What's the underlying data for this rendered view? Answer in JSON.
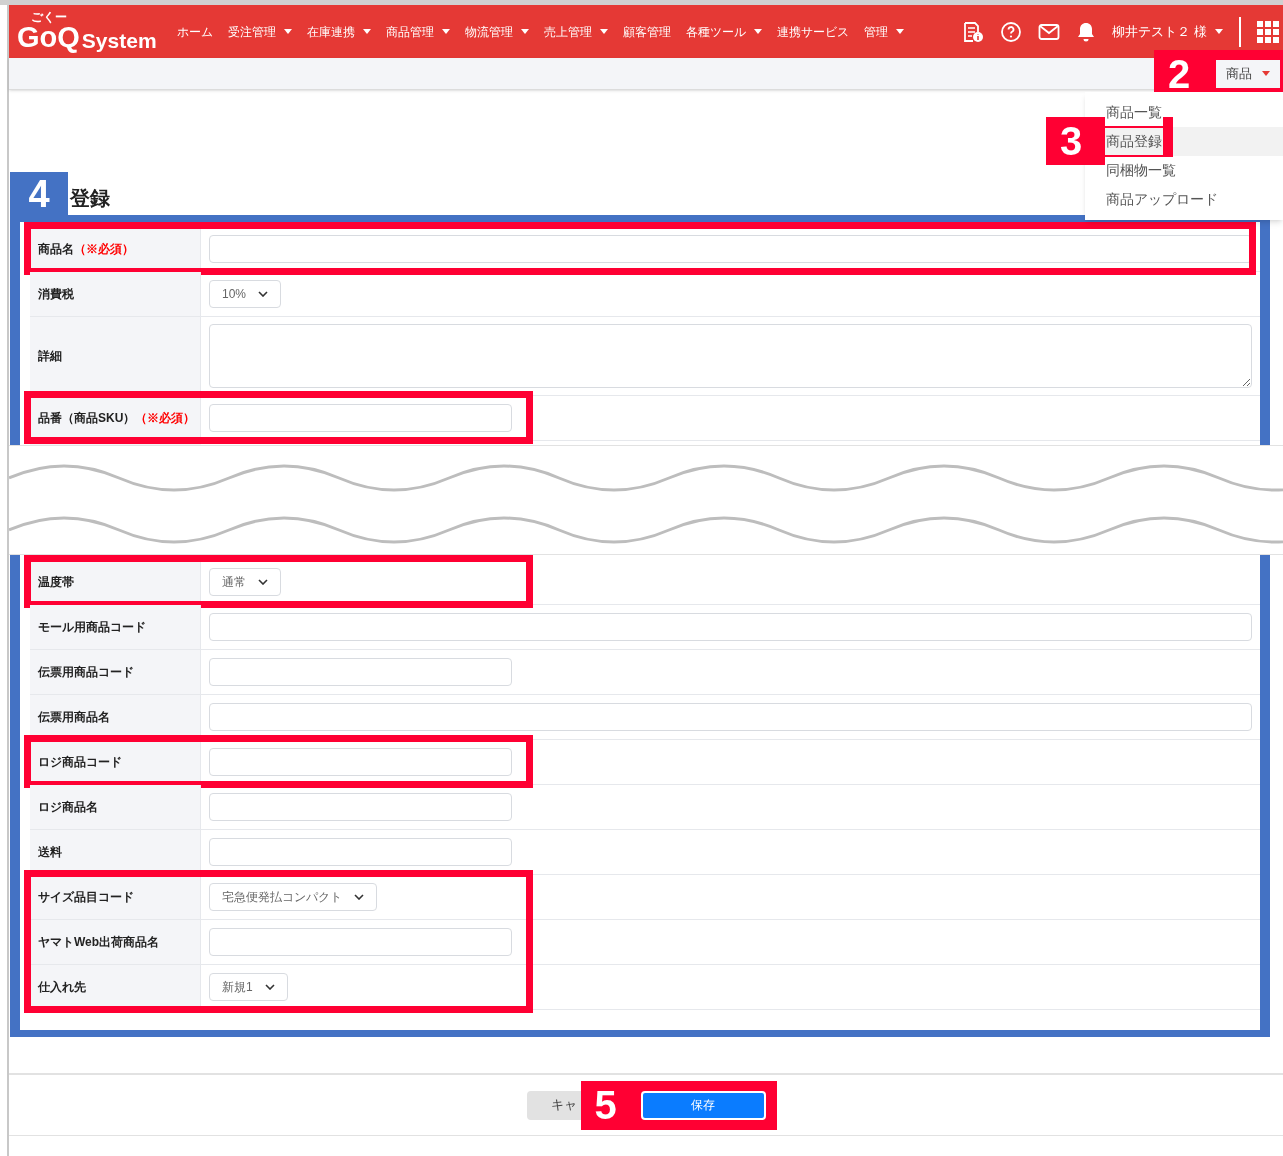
{
  "navbar": {
    "logo_ruby": "ごくー",
    "logo": "GoQ",
    "logo_sub": "System",
    "items": [
      {
        "label": "ホーム",
        "has_menu": false
      },
      {
        "label": "受注管理",
        "has_menu": true
      },
      {
        "label": "在庫連携",
        "has_menu": true
      },
      {
        "label": "商品管理",
        "has_menu": true
      },
      {
        "label": "物流管理",
        "has_menu": true
      },
      {
        "label": "売上管理",
        "has_menu": true
      },
      {
        "label": "顧客管理",
        "has_menu": false
      },
      {
        "label": "各種ツール",
        "has_menu": true
      },
      {
        "label": "連携サービス",
        "has_menu": false
      },
      {
        "label": "管理",
        "has_menu": true
      }
    ],
    "user": "柳井テスト２ 様"
  },
  "breadcrumb": {
    "button": "商品",
    "callout": "2"
  },
  "dropdown": {
    "callout": "3",
    "items": [
      {
        "label": "商品一覧",
        "selected": false
      },
      {
        "label": "商品登録",
        "selected": true
      },
      {
        "label": "同梱物一覧",
        "selected": false
      },
      {
        "label": "商品アップロード",
        "selected": false
      }
    ]
  },
  "page_title": {
    "callout": "4",
    "text": "登録"
  },
  "form": {
    "upper_groups": [
      {
        "annotated": true,
        "rows": [
          {
            "label": "商品名",
            "required": "（※必須）",
            "kind": "widefield"
          }
        ]
      },
      {
        "annotated": false,
        "rows": [
          {
            "label": "消費税",
            "kind": "select",
            "value": "10%"
          },
          {
            "label": "詳細",
            "kind": "textarea"
          }
        ]
      },
      {
        "annotated": true,
        "rows": [
          {
            "label": "品番（商品SKU）",
            "required": "（※必須）",
            "kind": "field"
          }
        ]
      }
    ],
    "lower_groups": [
      {
        "annotated": true,
        "rows": [
          {
            "label": "温度帯",
            "kind": "select",
            "value": "通常"
          }
        ]
      },
      {
        "annotated": false,
        "rows": [
          {
            "label": "モール用商品コード",
            "kind": "widefield"
          },
          {
            "label": "伝票用商品コード",
            "kind": "field"
          },
          {
            "label": "伝票用商品名",
            "kind": "widefield"
          }
        ]
      },
      {
        "annotated": true,
        "rows": [
          {
            "label": "ロジ商品コード",
            "kind": "field"
          }
        ]
      },
      {
        "annotated": false,
        "rows": [
          {
            "label": "ロジ商品名",
            "kind": "field"
          },
          {
            "label": "送料",
            "kind": "field"
          }
        ]
      },
      {
        "annotated": true,
        "rows": [
          {
            "label": "サイズ品目コード",
            "kind": "select",
            "value": "宅急便発払コンパクト"
          },
          {
            "label": "ヤマトWeb出荷商品名",
            "kind": "field"
          },
          {
            "label": "仕入れ先",
            "kind": "select",
            "value": "新規1"
          }
        ]
      }
    ]
  },
  "footer": {
    "callout": "5",
    "buttons": [
      {
        "label": "キャ",
        "kind": "secondary"
      },
      {
        "label": "保存",
        "kind": "primary"
      }
    ]
  }
}
